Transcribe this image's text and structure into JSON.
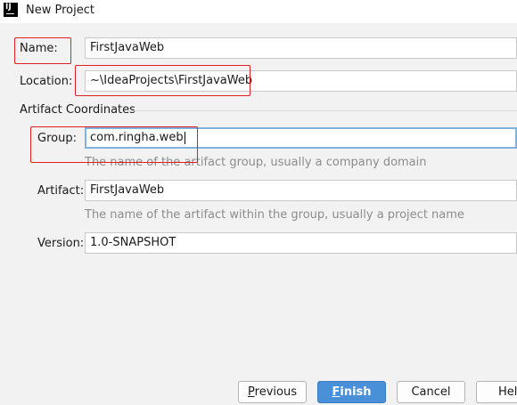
{
  "window": {
    "title": "New Project",
    "icon": "intellij-idea-icon"
  },
  "form": {
    "name": {
      "label": "Name:",
      "value": "FirstJavaWeb"
    },
    "location": {
      "label": "Location:",
      "value": "~\\IdeaProjects\\FirstJavaWeb"
    },
    "artifact_coordinates": {
      "section_title": "Artifact Coordinates",
      "group": {
        "label": "Group:",
        "value": "com.ringha.web",
        "hint": "The name of the artifact group, usually a company domain"
      },
      "artifact": {
        "label": "Artifact:",
        "value": "FirstJavaWeb",
        "hint": "The name of the artifact within the group, usually a project name"
      },
      "version": {
        "label": "Version:",
        "value": "1.0-SNAPSHOT"
      }
    }
  },
  "buttons": {
    "previous": {
      "mnemonic": "P",
      "rest": "revious"
    },
    "finish": {
      "mnemonic": "F",
      "rest": "inish"
    },
    "cancel": {
      "label": "Cancel"
    },
    "help": {
      "label": "Help"
    }
  },
  "colors": {
    "annotation": "#e02020",
    "focus_border": "#7fb2dd",
    "primary_button": "#4a90d9",
    "hint_text": "#8c8c8c"
  }
}
